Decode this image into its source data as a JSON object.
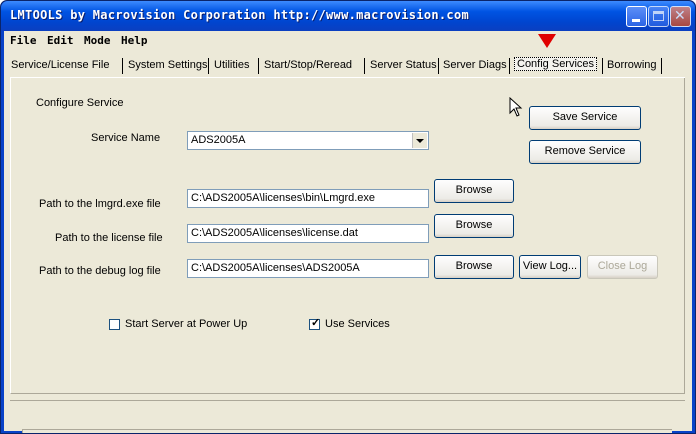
{
  "window": {
    "title": "LMTOOLS by Macrovision Corporation http://www.macrovision.com"
  },
  "menu": [
    "File",
    "Edit",
    "Mode",
    "Help"
  ],
  "tabs": [
    "Service/License File",
    "System Settings",
    "Utilities",
    "Start/Stop/Reread",
    "Server Status",
    "Server Diags",
    "Config Services",
    "Borrowing"
  ],
  "active_tab": "Config Services",
  "config": {
    "section_title": "Configure Service",
    "service_name_label": "Service Name",
    "service_name_value": "ADS2005A",
    "lmgrd_label": "Path to the lmgrd.exe file",
    "lmgrd_value": "C:\\ADS2005A\\licenses\\bin\\Lmgrd.exe",
    "license_label": "Path to the license file",
    "license_value": "C:\\ADS2005A\\licenses\\license.dat",
    "debug_label": "Path to the debug log file",
    "debug_value": "C:\\ADS2005A\\licenses\\ADS2005A",
    "browse_label": "Browse",
    "save_label": "Save Service",
    "remove_label": "Remove Service",
    "viewlog_label": "View Log...",
    "closelog_label": "Close Log",
    "start_at_powerup_label": "Start Server at Power Up",
    "start_at_powerup_checked": false,
    "use_services_label": "Use Services",
    "use_services_checked": true
  },
  "colors": {
    "title_bar": "#0054e3",
    "face": "#ece9d8",
    "pointer_marker": "#e00000"
  }
}
